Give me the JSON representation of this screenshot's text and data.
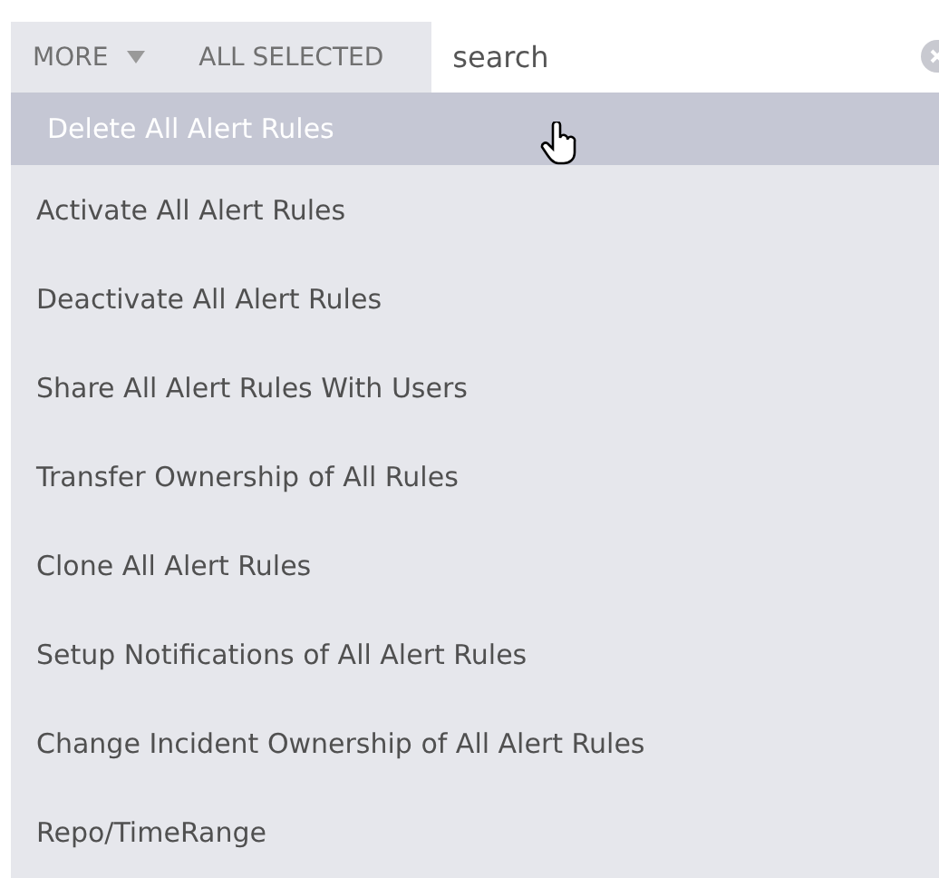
{
  "toolbar": {
    "more_label": "MORE",
    "all_selected_label": "ALL SELECTED",
    "search": {
      "value": "search"
    }
  },
  "menu": {
    "items": [
      {
        "label": "Delete All Alert Rules",
        "selected": true
      },
      {
        "label": "Activate All Alert Rules",
        "selected": false
      },
      {
        "label": "Deactivate All Alert Rules",
        "selected": false
      },
      {
        "label": "Share All Alert Rules With Users",
        "selected": false
      },
      {
        "label": "Transfer Ownership of All Rules",
        "selected": false
      },
      {
        "label": "Clone All Alert Rules",
        "selected": false
      },
      {
        "label": "Setup Notifications of All Alert Rules",
        "selected": false
      },
      {
        "label": "Change Incident Ownership of All Alert Rules",
        "selected": false
      },
      {
        "label": "Repo/TimeRange",
        "selected": false
      }
    ]
  }
}
